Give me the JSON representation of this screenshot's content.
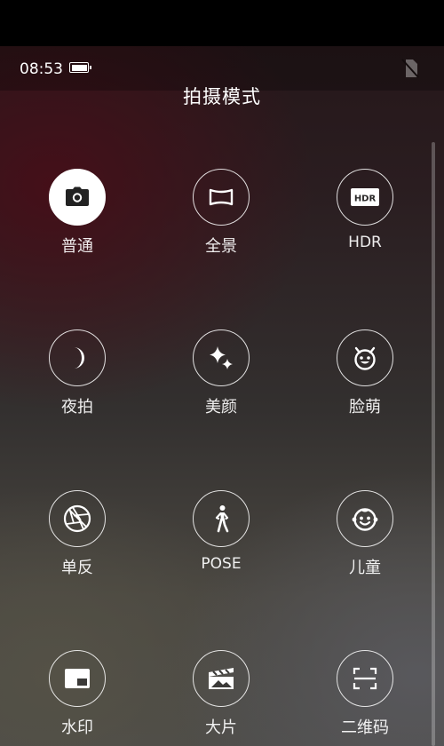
{
  "status_bar": {
    "time": "08:53"
  },
  "page": {
    "title": "拍摄模式"
  },
  "modes": [
    {
      "label": "普通",
      "icon": "camera-icon",
      "selected": true
    },
    {
      "label": "全景",
      "icon": "panorama-icon",
      "selected": false
    },
    {
      "label": "HDR",
      "icon": "hdr-icon",
      "selected": false
    },
    {
      "label": "夜拍",
      "icon": "moon-icon",
      "selected": false
    },
    {
      "label": "美颜",
      "icon": "sparkle-icon",
      "selected": false
    },
    {
      "label": "脸萌",
      "icon": "cute-face-icon",
      "selected": false
    },
    {
      "label": "单反",
      "icon": "aperture-icon",
      "selected": false
    },
    {
      "label": "POSE",
      "icon": "walking-person-icon",
      "selected": false
    },
    {
      "label": "儿童",
      "icon": "baby-face-icon",
      "selected": false
    },
    {
      "label": "水印",
      "icon": "watermark-icon",
      "selected": false
    },
    {
      "label": "大片",
      "icon": "clapperboard-icon",
      "selected": false
    },
    {
      "label": "二维码",
      "icon": "qr-scan-icon",
      "selected": false
    }
  ],
  "icon_badges": {
    "hdr": "HDR"
  }
}
